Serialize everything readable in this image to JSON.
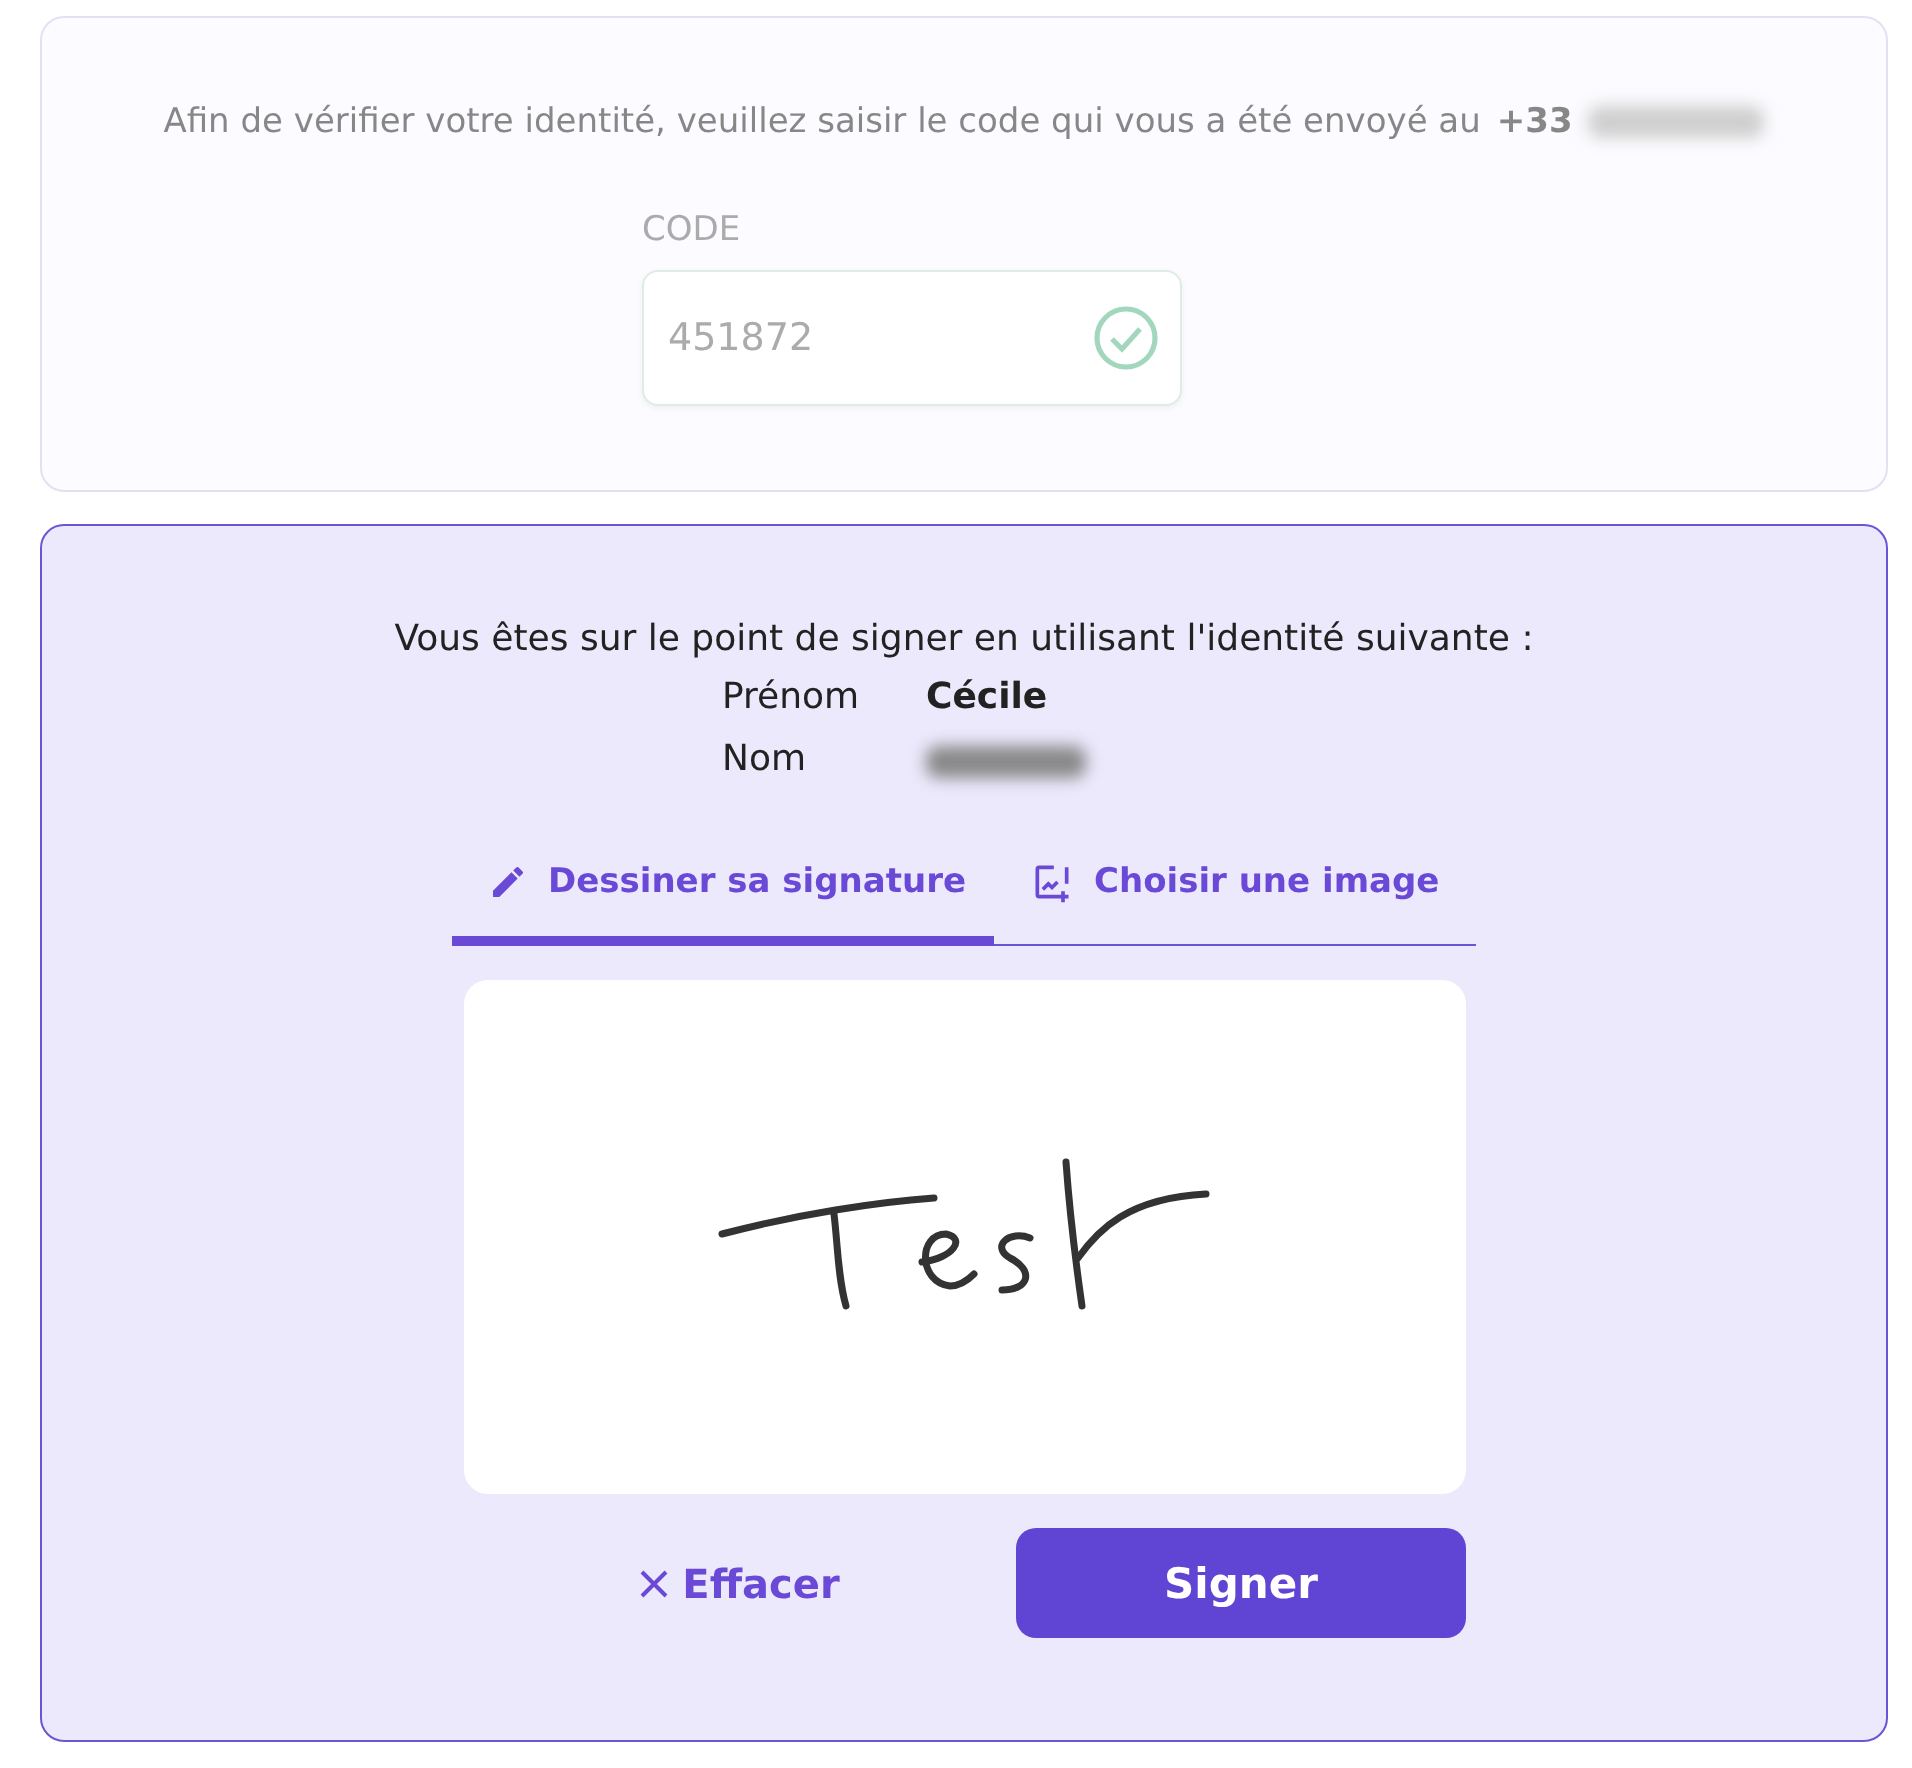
{
  "code_step": {
    "message_start": "Afin de vérifier votre identité, veuillez saisir le code qui vous a été envoyé au",
    "phone_prefix": "+33",
    "code_label": "CODE",
    "code_value": "451872",
    "verified": true
  },
  "signature_step": {
    "intro": "Vous êtes sur le point de signer en utilisant l'identité suivante :",
    "identity": [
      {
        "label": "Prénom",
        "value": "Cécile"
      },
      {
        "label": "Nom",
        "redacted": true
      }
    ],
    "tabs": [
      {
        "label": "Dessiner sa signature",
        "selected": true,
        "kind": "draw"
      },
      {
        "label": "Choisir une image",
        "selected": false,
        "kind": "image"
      }
    ],
    "clear_button": "Effacer",
    "sign_button": "Signer"
  }
}
